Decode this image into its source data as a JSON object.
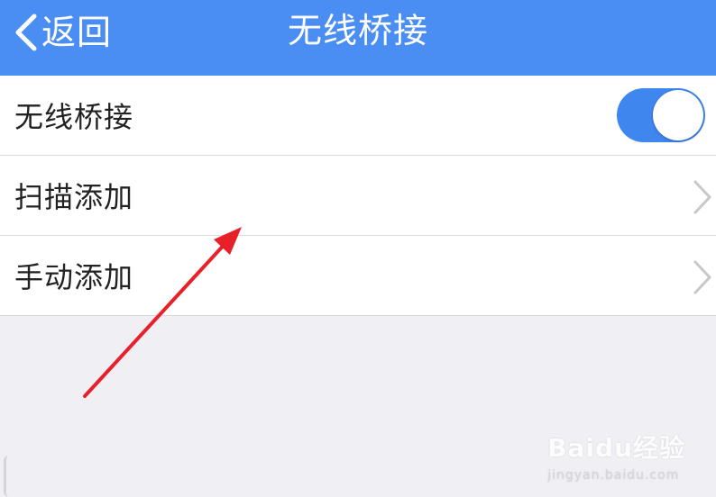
{
  "navbar": {
    "back_label": "返回",
    "title": "无线桥接"
  },
  "list": {
    "items": [
      {
        "label": "无线桥接",
        "control": "toggle",
        "toggle_state": "on"
      },
      {
        "label": "扫描添加",
        "control": "chevron"
      },
      {
        "label": "手动添加",
        "control": "chevron"
      }
    ]
  },
  "watermark": {
    "main": "Baidu经验",
    "sub": "jingyan.baidu.com"
  },
  "colors": {
    "navbar_bg": "#4a8df3",
    "toggle_on": "#3f86ef",
    "page_bg": "#efeff4",
    "annotation_arrow": "#e8202a"
  },
  "icons": {
    "back": "chevron-left-icon",
    "row_disclosure": "chevron-right-icon",
    "annotation": "red-arrow"
  }
}
